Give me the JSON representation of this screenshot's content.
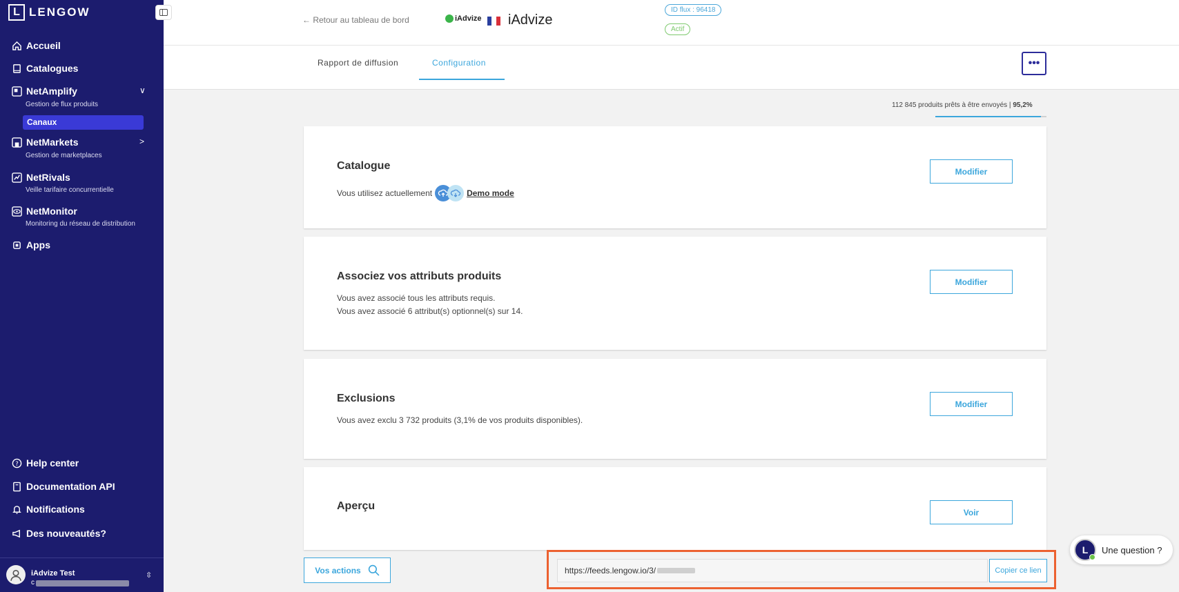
{
  "sidebar": {
    "logo_letter": "L",
    "logo_text": "LENGOW",
    "items": [
      {
        "label": "Accueil"
      },
      {
        "label": "Catalogues"
      },
      {
        "label": "NetAmplify",
        "sub": "Gestion de flux produits"
      },
      {
        "label": "NetMarkets",
        "sub": "Gestion de marketplaces"
      },
      {
        "label": "NetRivals",
        "sub": "Veille tarifaire concurrentielle"
      },
      {
        "label": "NetMonitor",
        "sub": "Monitoring du réseau de distribution"
      },
      {
        "label": "Apps"
      }
    ],
    "active_sub": "Canaux",
    "bottom_items": [
      {
        "label": "Help center"
      },
      {
        "label": "Documentation API"
      },
      {
        "label": "Notifications"
      },
      {
        "label": "Des nouveautés?"
      }
    ],
    "user": {
      "name": "iAdvize Test",
      "email_initial": "c"
    }
  },
  "header": {
    "back_link": "← Retour au tableau de bord",
    "brand_mini": "iAdvize",
    "title": "iAdvize",
    "id_badge": "ID flux : 96418",
    "status_badge": "Actif",
    "tabs": [
      {
        "label": "Rapport de diffusion"
      },
      {
        "label": "Configuration"
      }
    ],
    "more_label": "•••"
  },
  "progress": {
    "text": "112 845 produits prêts à être envoyés | ",
    "percent_label": "95,2%",
    "value": 95.2
  },
  "cards": [
    {
      "title": "Catalogue",
      "text": "Vous utilisez actuellement",
      "link": "Demo mode",
      "button": "Modifier"
    },
    {
      "title": "Associez vos attributs produits",
      "line1": "Vous avez associé tous les attributs requis.",
      "line2": "Vous avez associé 6 attribut(s) optionnel(s) sur 14.",
      "button": "Modifier"
    },
    {
      "title": "Exclusions",
      "text": "Vous avez exclu 3 732 produits (3,1% de vos produits disponibles).",
      "button": "Modifier"
    },
    {
      "title": "Aperçu",
      "button": "Voir"
    }
  ],
  "bottom": {
    "actions_label": "Vos actions",
    "feed_url": "https://feeds.lengow.io/3/",
    "copy_label": "Copier ce lien"
  },
  "help": {
    "avatar_letter": "L",
    "text": "Une question ?"
  },
  "colors": {
    "sidebar_bg": "#1c1c6e",
    "accent": "#3ba6dc",
    "highlight": "#ec6130",
    "active_nav": "#3a3ad6"
  }
}
